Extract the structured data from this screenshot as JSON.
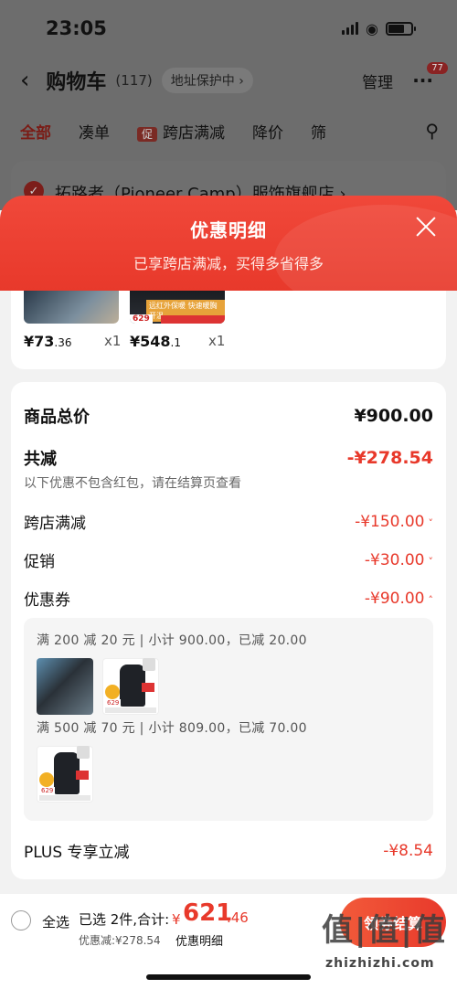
{
  "status": {
    "time": "23:05"
  },
  "header": {
    "back_icon": "chevron-left-icon",
    "title": "购物车",
    "count": "(117)",
    "address": "地址保护中",
    "manage": "管理",
    "more_badge": "77"
  },
  "tabs": [
    {
      "label": "全部",
      "active": true
    },
    {
      "label": "凑单"
    },
    {
      "label": "跨店满减",
      "tag": "促"
    },
    {
      "label": "降价"
    },
    {
      "label": "筛"
    }
  ],
  "shop": {
    "name": "拓路者（Pioneer Camp）服饰旗舰店 ›"
  },
  "sheet": {
    "title": "优惠明细",
    "subtitle": "已享跨店满减，买得多省得多"
  },
  "items": [
    {
      "price": "¥73",
      "price_dec": ".36",
      "qty": "x1",
      "thumb_price": ""
    },
    {
      "price": "¥548",
      "price_dec": ".1",
      "qty": "x1",
      "thumb_price": "629",
      "tag": "远红外保暖 快速暖胸开温"
    }
  ],
  "breakdown": {
    "total_label": "商品总价",
    "total_value": "¥900.00",
    "reduce_label": "共减",
    "reduce_value": "-¥278.54",
    "note": "以下优惠不包含红包，请在结算页查看",
    "rows": [
      {
        "label": "跨店满减",
        "value": "-¥150.00"
      },
      {
        "label": "促销",
        "value": "-¥30.00"
      },
      {
        "label": "优惠券",
        "value": "-¥90.00"
      }
    ],
    "coupons": [
      {
        "text": "满 200 减 20 元 | 小计 900.00，已减 20.00"
      },
      {
        "text": "满 500 减 70 元 | 小计 809.00，已减 70.00"
      }
    ],
    "plus_label": "PLUS 专享立减",
    "plus_value": "-¥8.54"
  },
  "bottom": {
    "select_all": "全选",
    "selected": "已选 2件,合计:",
    "yen": "¥",
    "total_int": "621",
    "total_dec": ".46",
    "discount": "优惠减:¥278.54",
    "detail_link": "优惠明细",
    "checkout": "领券结算",
    "watermark": "值|值|值",
    "watermark_url": "zhizhizhi.com"
  }
}
